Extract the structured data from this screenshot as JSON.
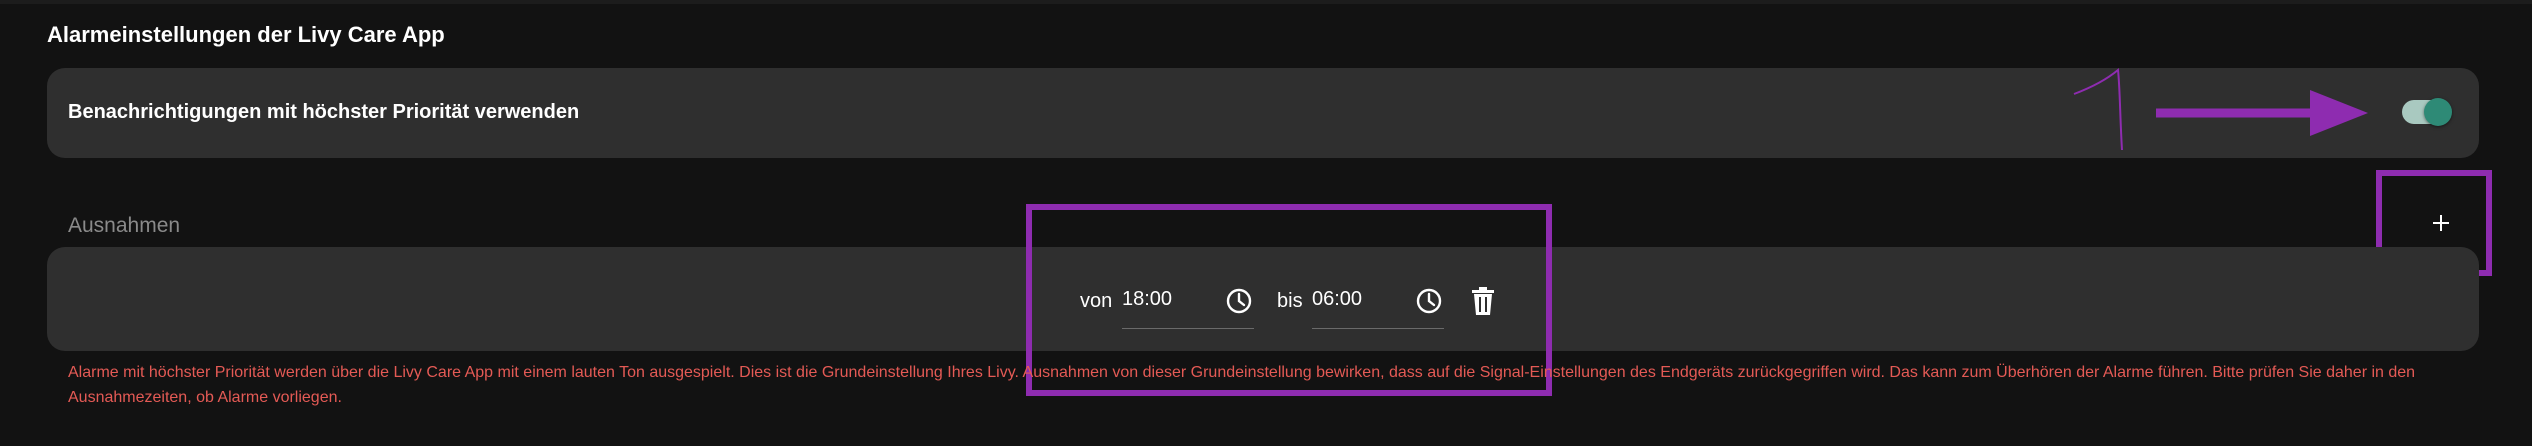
{
  "section": {
    "title": "Alarmeinstellungen der Livy Care App"
  },
  "priority": {
    "label": "Benachrichtigungen mit höchster Priorität verwenden",
    "enabled": true
  },
  "exceptions": {
    "label": "Ausnahmen",
    "add_icon": "plus-icon",
    "items": [
      {
        "from_label": "von",
        "from_value": "18:00",
        "to_label": "bis",
        "to_value": "06:00",
        "clock_icon": "clock-icon",
        "delete_icon": "trash-icon"
      }
    ]
  },
  "warning": {
    "text": "Alarme mit höchster Priorität werden über die Livy Care App mit einem lauten Ton ausgespielt. Dies ist die Grundeinstellung Ihres Livy. Ausnahmen von dieser Grundeinstellung bewirken, dass auf die Signal-Einstellungen des Endgeräts zurückgegriffen wird. Das kann zum Überhören der Alarme führen. Bitte prüfen Sie daher in den Ausnahmezeiten, ob Alarme vorliegen."
  },
  "colors": {
    "background": "#121212",
    "card": "#2f2f2f",
    "toggle_track": "#a9c9c0",
    "toggle_knob": "#2e8a76",
    "warning": "#e45a55",
    "annotation": "#8e2cb0"
  }
}
